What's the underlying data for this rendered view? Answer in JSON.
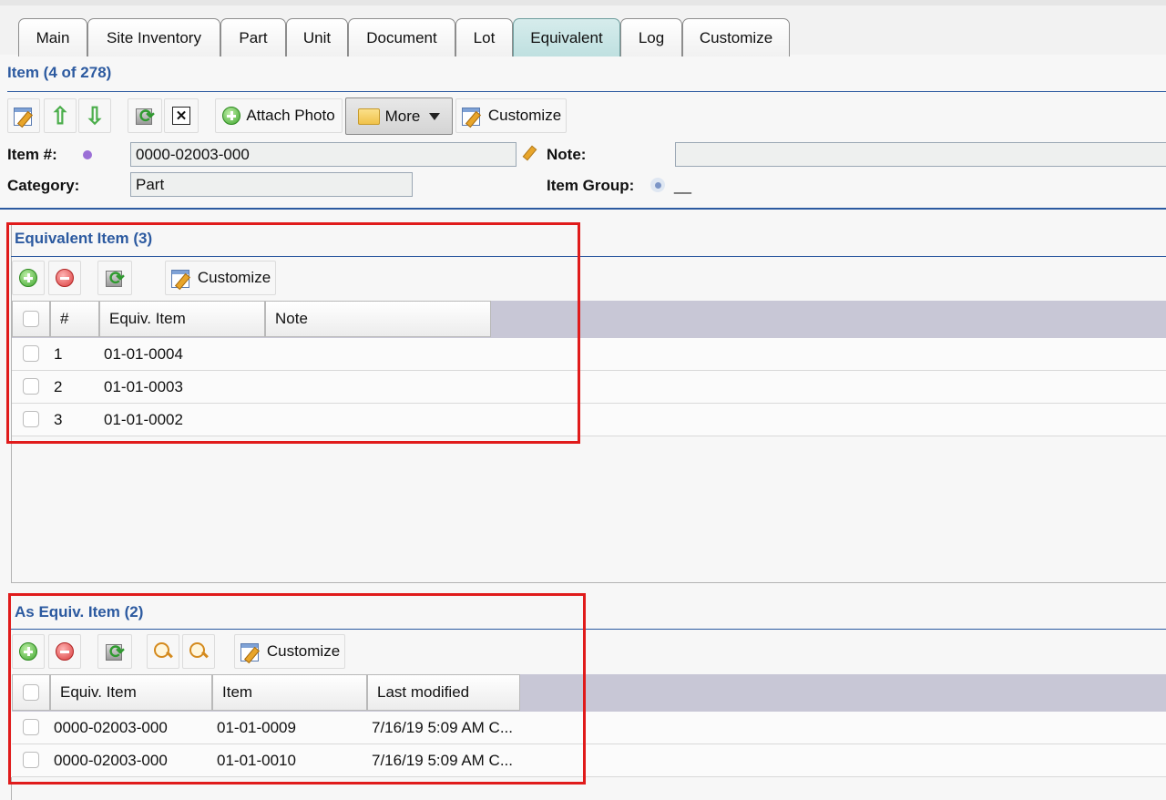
{
  "tabs": [
    {
      "label": "Main"
    },
    {
      "label": "Site Inventory"
    },
    {
      "label": "Part"
    },
    {
      "label": "Unit"
    },
    {
      "label": "Document"
    },
    {
      "label": "Lot"
    },
    {
      "label": "Equivalent"
    },
    {
      "label": "Log"
    },
    {
      "label": "Customize"
    }
  ],
  "active_tab": "Equivalent",
  "item_header": {
    "title": "Item (4 of 278)"
  },
  "item_toolbar": {
    "attach_photo_label": "Attach Photo",
    "more_label": "More",
    "customize_label": "Customize"
  },
  "item_form": {
    "item_no_label": "Item #:",
    "item_no_value": "0000-02003-000",
    "note_label": "Note:",
    "note_value": "",
    "category_label": "Category:",
    "category_value": "Part",
    "item_group_label": "Item Group:",
    "item_group_value": "__"
  },
  "equivalent_section": {
    "title": "Equivalent Item (3)",
    "customize_label": "Customize",
    "columns": [
      "#",
      "Equiv. Item",
      "Note"
    ],
    "rows": [
      {
        "num": "1",
        "equiv_item": "01-01-0004",
        "note": ""
      },
      {
        "num": "2",
        "equiv_item": "01-01-0003",
        "note": ""
      },
      {
        "num": "3",
        "equiv_item": "01-01-0002",
        "note": ""
      }
    ]
  },
  "as_equiv_section": {
    "title": "As Equiv. Item (2)",
    "customize_label": "Customize",
    "columns": [
      "Equiv. Item",
      "Item",
      "Last modified"
    ],
    "rows": [
      {
        "equiv_item": "0000-02003-000",
        "item": "01-01-0009",
        "last_modified": "7/16/19 5:09 AM C..."
      },
      {
        "equiv_item": "0000-02003-000",
        "item": "01-01-0010",
        "last_modified": "7/16/19 5:09 AM C..."
      }
    ]
  },
  "colors": {
    "accent_blue": "#2c5aa0",
    "highlight_red": "#e01b1b",
    "active_tab": "#c8e4e4"
  }
}
